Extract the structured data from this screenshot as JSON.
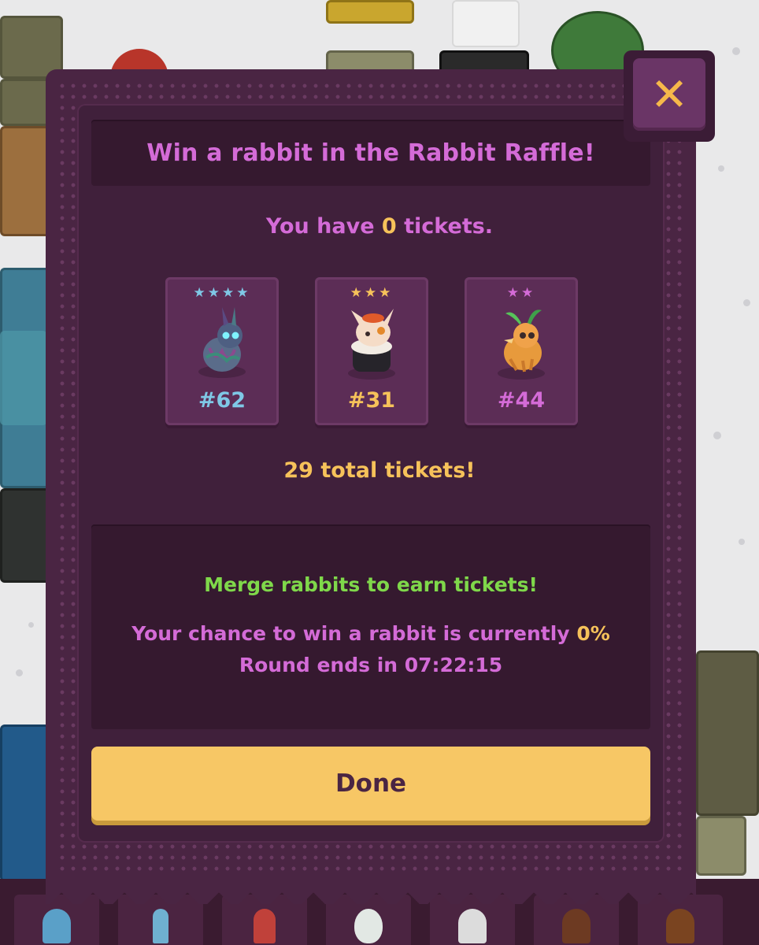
{
  "modal": {
    "title": "Win a rabbit in the Rabbit Raffle!",
    "close_icon": "close-icon",
    "tickets_prefix": "You have",
    "tickets_count": "0",
    "tickets_suffix": "tickets.",
    "total_tickets_text": "29 total tickets!",
    "merge_hint": "Merge rabbits to earn tickets!",
    "chance_prefix": "Your chance to win a rabbit is currently",
    "chance_value": "0%",
    "round_text": "Round ends in 07:22:15",
    "done_label": "Done"
  },
  "prizes": [
    {
      "stars": "★★★★",
      "rating": 4,
      "number": "#62",
      "color": "#7fc8e6",
      "icon": "rainbow-rabbit-icon"
    },
    {
      "stars": "★★★",
      "rating": 3,
      "number": "#31",
      "color": "#f6c25a",
      "icon": "sushi-rabbit-icon"
    },
    {
      "stars": "★★",
      "rating": 2,
      "number": "#44",
      "color": "#d46bd7",
      "icon": "mandrake-rabbit-icon"
    }
  ],
  "colors": {
    "modal_bg": "#4a2543",
    "panel_bg": "#35192f",
    "accent_pink": "#d46bd7",
    "accent_yellow": "#f6c25a",
    "accent_green": "#7fd84a",
    "button_yellow": "#f7c765"
  }
}
